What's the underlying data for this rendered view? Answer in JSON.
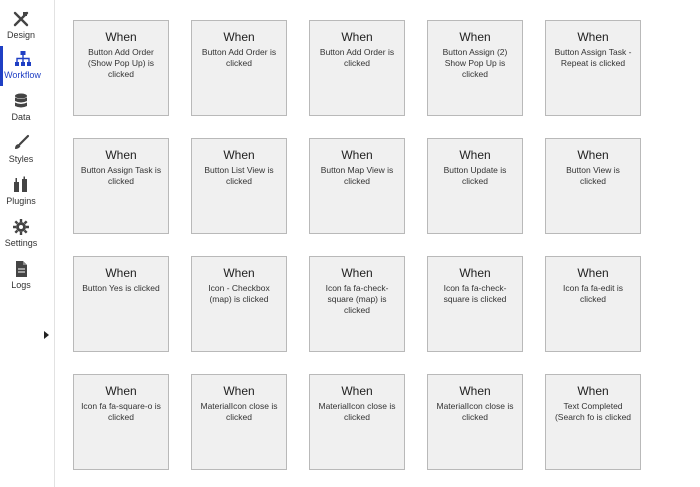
{
  "sidebar": {
    "items": [
      {
        "label": "Design",
        "icon": "design-tools-icon",
        "active": false
      },
      {
        "label": "Workflow",
        "icon": "workflow-icon",
        "active": true
      },
      {
        "label": "Data",
        "icon": "database-icon",
        "active": false
      },
      {
        "label": "Styles",
        "icon": "brush-icon",
        "active": false
      },
      {
        "label": "Plugins",
        "icon": "plug-icon",
        "active": false
      },
      {
        "label": "Settings",
        "icon": "gear-icon",
        "active": false
      },
      {
        "label": "Logs",
        "icon": "document-icon",
        "active": false
      }
    ],
    "accent": "#1f3fc4"
  },
  "workflow": {
    "event_heading": "When",
    "events": [
      "Button Add Order (Show Pop Up) is clicked",
      "Button Add Order is clicked",
      "Button Add Order is clicked",
      "Button Assign (2) Show Pop Up is clicked",
      "Button Assign Task - Repeat is clicked",
      "Button Assign Task is clicked",
      "Button List View is clicked",
      "Button Map View is clicked",
      "Button Update is clicked",
      "Button View is clicked",
      "Button Yes is clicked",
      "Icon - Checkbox (map) is clicked",
      "Icon fa fa-check-square (map) is clicked",
      "Icon fa fa-check-square is clicked",
      "Icon fa fa-edit is clicked",
      "Icon fa fa-square-o is clicked",
      "MaterialIcon close is clicked",
      "MaterialIcon close is clicked",
      "MaterialIcon close is clicked",
      "Text Completed (Search fo is clicked"
    ]
  }
}
